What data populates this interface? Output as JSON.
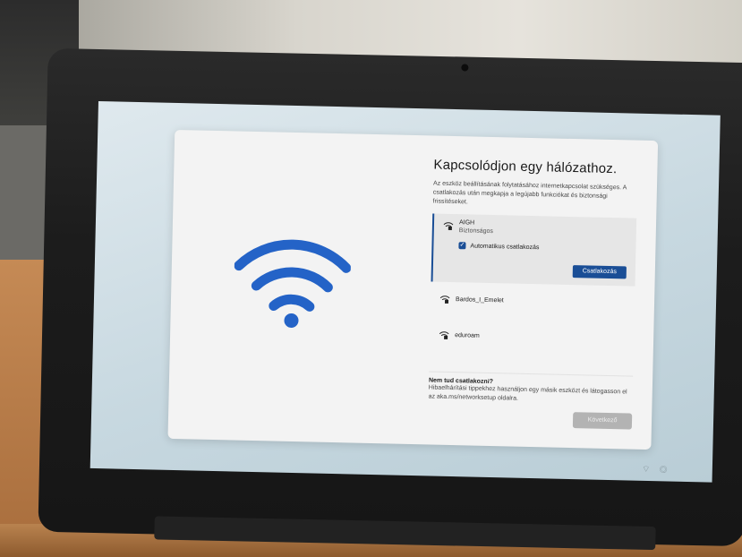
{
  "dialog": {
    "title": "Kapcsolódjon egy hálózathoz.",
    "description": "Az eszköz beállításának folytatásához internetkapcsolat szükséges. A csatlakozás után megkapja a legújabb funkciókat és biztonsági frissítéseket.",
    "networks": [
      {
        "name": "AIGH",
        "security": "Biztonságos",
        "icon": "wifi-lock-icon"
      },
      {
        "name": "Bardos_I_Emelet",
        "icon": "wifi-lock-icon"
      },
      {
        "name": "eduroam",
        "icon": "wifi-lock-icon"
      }
    ],
    "auto_connect_label": "Automatikus csatlakozás",
    "auto_connect_checked": true,
    "connect_label": "Csatlakozás",
    "help_title": "Nem tud csatlakozni?",
    "help_text": "Hibaelhárítási tippekhez használjon egy másik eszközt és látogasson el az aka.ms/networksetup oldalra.",
    "next_label": "Következő",
    "accent_color": "#1a4e96",
    "wifi_art_color": "#2463c7"
  }
}
